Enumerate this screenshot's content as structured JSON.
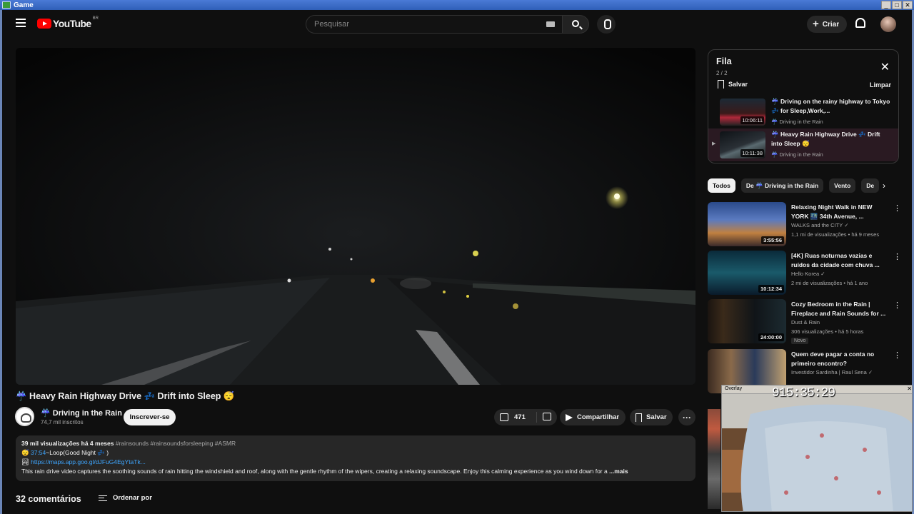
{
  "window": {
    "title": "Game",
    "controls": [
      "_",
      "□",
      "✕"
    ]
  },
  "header": {
    "logo_text": "YouTube",
    "country_code": "BR",
    "search_placeholder": "Pesquisar",
    "create_label": "Criar"
  },
  "video": {
    "title": "☔ Heavy Rain Highway Drive 💤 Drift into Sleep 😴",
    "channel_name": "☔ Driving in the Rain",
    "subscribers": "74,7 mil inscritos",
    "subscribe_label": "Inscrever-se",
    "likes": "471",
    "share_label": "Compartilhar",
    "save_label": "Salvar",
    "more_label": "···"
  },
  "description": {
    "views": "39 mil visualizações",
    "age": "há 4 meses",
    "tags": "#rainsounds #rainsoundsforsleeping #ASMR",
    "timestamp": "37:54",
    "timestamp_text": "~Loop(Good Night 💤 )",
    "link": "https://maps.app.goo.gl/dJFuG4EgYtaTk...",
    "body": "This rain drive video captures the soothing sounds of rain hitting the windshield and roof, along with the gentle rhythm of the wipers, creating a relaxing soundscape. Enjoy this calming experience as you wind down for a",
    "more_label": "...mais"
  },
  "comments": {
    "count_label": "32 comentários",
    "sort_label": "Ordenar por"
  },
  "queue": {
    "title": "Fila",
    "count": "2 / 2",
    "save_label": "Salvar",
    "clear_label": "Limpar",
    "items": [
      {
        "title": "☔ Driving on the rainy highway to Tokyo 💤 for Sleep,Work,...",
        "channel": "☔ Driving in the Rain",
        "duration": "10:06:11"
      },
      {
        "title": "☔ Heavy Rain Highway Drive 💤 Drift into Sleep 😴",
        "channel": "☔ Driving in the Rain",
        "duration": "10:11:38"
      }
    ]
  },
  "chips": [
    "Todos",
    "De ☔ Driving in the Rain",
    "Vento",
    "De"
  ],
  "recommendations": [
    {
      "title": "Relaxing Night Walk in NEW YORK 🌃 34th Avenue, ...",
      "channel": "WALKS and the CITY ✓",
      "meta": "1,1 mi de visualizações • há 9 meses",
      "duration": "3:55:56",
      "badge": ""
    },
    {
      "title": "[4K] Ruas noturnas vazias e ruídos da cidade com chuva ...",
      "channel": "Hello Korea ✓",
      "meta": "2 mi de visualizações • há 1 ano",
      "duration": "10:12:34",
      "badge": ""
    },
    {
      "title": "Cozy Bedroom in the Rain | Fireplace and Rain Sounds for ...",
      "channel": "Dust & Rain",
      "meta": "306 visualizações • há 5 horas",
      "duration": "24:00:00",
      "badge": "Novo"
    },
    {
      "title": "Quem deve pagar a conta no primeiro encontro?",
      "channel": "Investidor Sardinha | Raul Sena ✓",
      "meta": "",
      "duration": "",
      "badge": ""
    }
  ],
  "webcam": {
    "title": "Overlay",
    "time": "915:35:29"
  },
  "colors": {
    "accent_red": "#ff0000",
    "link_blue": "#3ea6ff",
    "background": "#0f0f0f"
  }
}
